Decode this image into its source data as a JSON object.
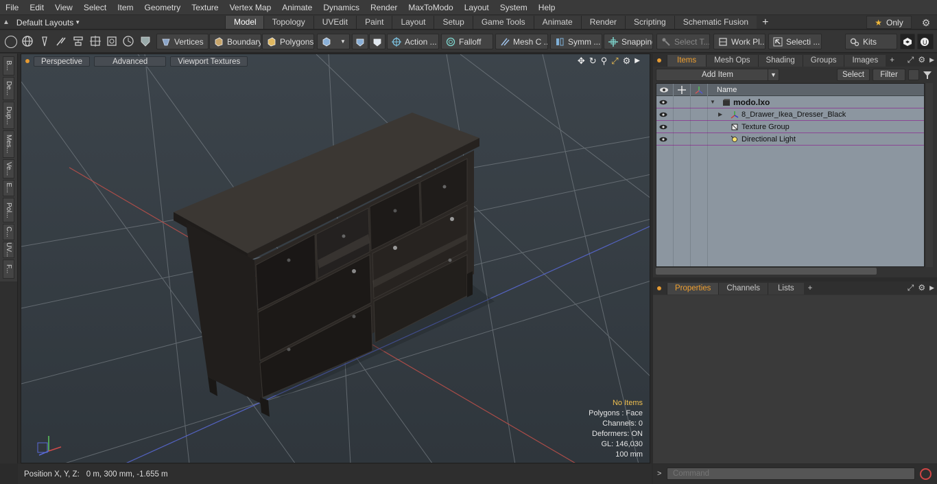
{
  "menu": [
    "File",
    "Edit",
    "View",
    "Select",
    "Item",
    "Geometry",
    "Texture",
    "Vertex Map",
    "Animate",
    "Dynamics",
    "Render",
    "MaxToModo",
    "Layout",
    "System",
    "Help"
  ],
  "layout_picker": {
    "label": "Default Layouts"
  },
  "layout_tabs": [
    "Model",
    "Topology",
    "UVEdit",
    "Paint",
    "Layout",
    "Setup",
    "Game Tools",
    "Animate",
    "Render",
    "Scripting",
    "Schematic Fusion"
  ],
  "active_layout_tab": "Model",
  "only_button": {
    "label": "Only"
  },
  "toolbar": {
    "vertices": "Vertices",
    "boundary": "Boundary",
    "polygons": "Polygons",
    "action": "Action ...",
    "falloff": "Falloff",
    "mesh_c": "Mesh C ...",
    "symm": "Symm ...",
    "snapping": "Snapping",
    "select_t": "Select T...",
    "work_pl": "Work Pl...",
    "selecti": "Selecti ...",
    "kits": "Kits"
  },
  "left_strip_tabs": [
    "B...",
    "De...",
    "Dup...",
    "Mes...",
    "Ve...",
    "E...",
    "Pol...",
    "C...",
    "UV...",
    "F..."
  ],
  "viewport": {
    "buttons": [
      "Perspective",
      "Advanced",
      "Viewport Textures"
    ],
    "info": {
      "no_items": "No Items",
      "polygons": "Polygons : Face",
      "channels": "Channels: 0",
      "deformers": "Deformers: ON",
      "gl": "GL: 146,030",
      "scale": "100 mm"
    }
  },
  "status": {
    "label": "Position X, Y, Z:",
    "value": "0 m, 300 mm, -1.655 m"
  },
  "items_panel": {
    "tabs": [
      "Items",
      "Mesh Ops",
      "Shading",
      "Groups",
      "Images"
    ],
    "active_tab": "Items",
    "add_item": "Add Item",
    "select": "Select",
    "filter": "Filter",
    "column_name": "Name",
    "rows": [
      {
        "label": "modo.lxo",
        "icon": "scene-icon",
        "level": 0
      },
      {
        "label": "8_Drawer_Ikea_Dresser_Black",
        "icon": "mesh-locator-icon",
        "level": 1
      },
      {
        "label": "Texture Group",
        "icon": "texture-group-icon",
        "level": 1
      },
      {
        "label": "Directional Light",
        "icon": "light-icon",
        "level": 1
      }
    ]
  },
  "props_panel": {
    "tabs": [
      "Properties",
      "Channels",
      "Lists"
    ],
    "active_tab": "Properties"
  },
  "command": {
    "prompt": ">",
    "placeholder": "Command"
  },
  "colors": {
    "accent_orange": "#f0a030",
    "warning_yellow": "#f0c050",
    "list_bg": "#8c96a0",
    "viewport_bg": "#3a4148"
  }
}
